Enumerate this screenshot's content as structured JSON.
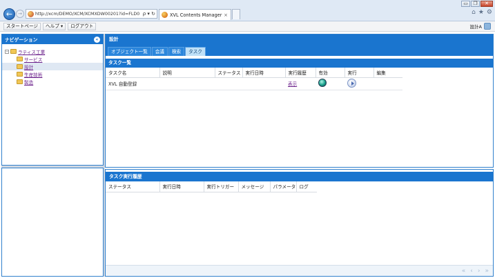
{
  "browser": {
    "url": "http://xcm/DEMO/XCM/XCMXDW00201?id=FLD0",
    "address_controls": "ρ ▾ ↻",
    "tab_title": "XVL Contents Manager",
    "tab_close": "×",
    "window_buttons": [
      "▭",
      "❐",
      "✕"
    ],
    "tool_icons": [
      "⌂",
      "★",
      "⚙"
    ]
  },
  "toolbar": {
    "start_page": "スタートページ",
    "help": "ヘルプ ▾",
    "logout": "ログアウト",
    "user_name": "設計A"
  },
  "navigation": {
    "title": "ナビゲーション",
    "collapse_symbol": "«",
    "tree": [
      {
        "label": "ラティス工業",
        "level": 0,
        "expander": "−"
      },
      {
        "label": "サービス",
        "level": 1
      },
      {
        "label": "設計",
        "level": 1,
        "selected": true
      },
      {
        "label": "生産技術",
        "level": 1
      },
      {
        "label": "製造",
        "level": 1
      }
    ]
  },
  "main": {
    "title": "設計",
    "tabs": [
      {
        "label": "オブジェクト一覧",
        "active": false
      },
      {
        "label": "会議",
        "active": false
      },
      {
        "label": "検索",
        "active": false
      },
      {
        "label": "タスク",
        "active": true
      }
    ],
    "task_list": {
      "title": "タスク一覧",
      "columns": [
        "タスク名",
        "説明",
        "ステータス",
        "実行日時",
        "実行履歴",
        "有効",
        "実行",
        "編集"
      ],
      "rows": [
        {
          "name": "XVL 自動登録",
          "description": "",
          "status": "",
          "datetime": "",
          "history_link": "表示"
        }
      ]
    },
    "task_history": {
      "title": "タスク実行履歴",
      "columns": [
        "ステータス",
        "実行日時",
        "実行トリガー",
        "メッセージ",
        "パラメータ",
        "ログ"
      ],
      "pager": [
        "«",
        "‹",
        "›",
        "»"
      ]
    }
  }
}
